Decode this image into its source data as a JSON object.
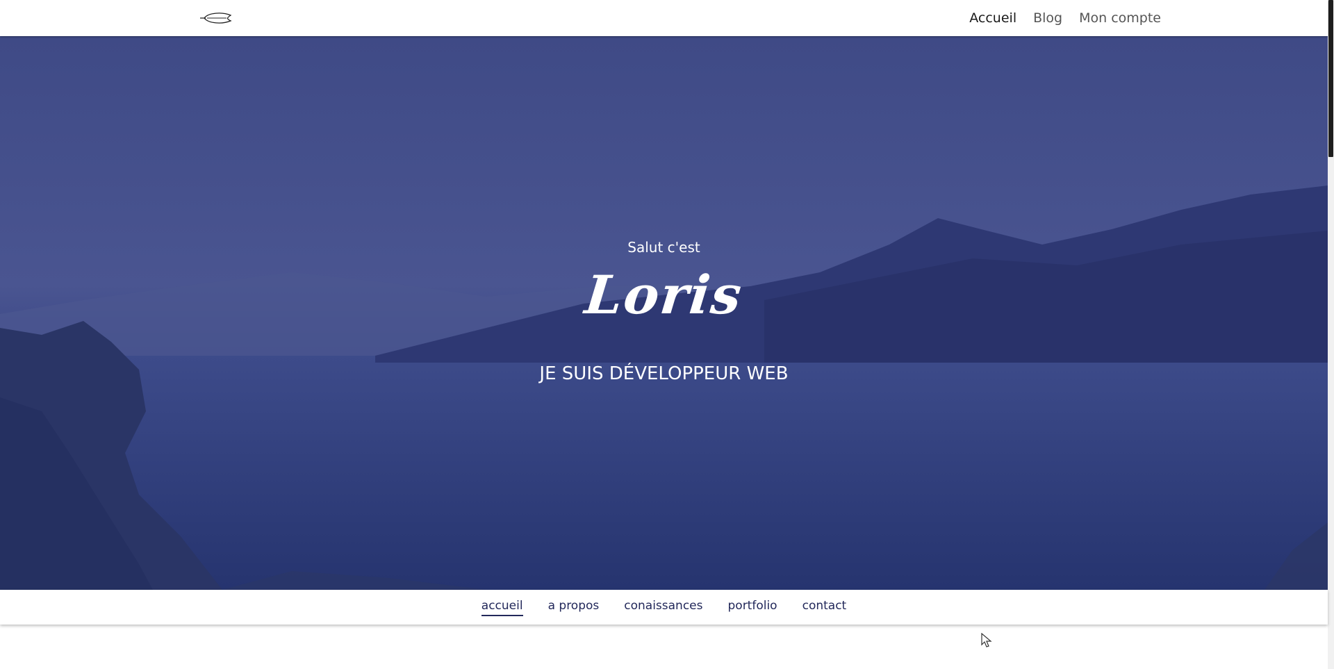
{
  "header": {
    "logo_icon": "feather-icon",
    "nav": [
      {
        "label": "Accueil",
        "active": true
      },
      {
        "label": "Blog",
        "active": false
      },
      {
        "label": "Mon compte",
        "active": false
      }
    ]
  },
  "hero": {
    "greeting": "Salut c'est",
    "name": "Loris",
    "role": "JE SUIS DÉVELOPPEUR WEB",
    "overlay_color": "#3b4784"
  },
  "section_nav": {
    "items": [
      {
        "label": "accueil",
        "active": true
      },
      {
        "label": "a propos",
        "active": false
      },
      {
        "label": "conaissances",
        "active": false
      },
      {
        "label": "portfolio",
        "active": false
      },
      {
        "label": "contact",
        "active": false
      }
    ],
    "color": "#22285a"
  }
}
